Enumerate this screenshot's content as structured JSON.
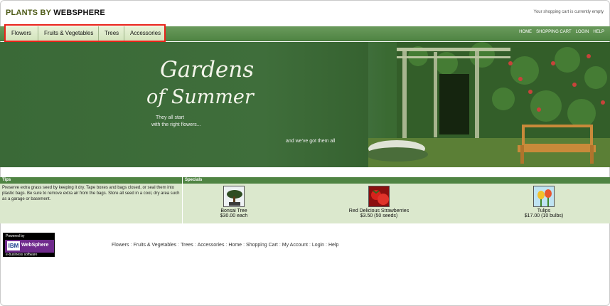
{
  "header": {
    "logo_part1": "PLANTS BY",
    "logo_part2": "WEBSPHERE",
    "cart_status": "Your shopping cart is currently empty"
  },
  "nav": {
    "categories": [
      "Flowers",
      "Fruits & Vegetables",
      "Trees",
      "Accessories"
    ],
    "utility": [
      "HOME",
      "SHOPPING CART",
      "LOGIN",
      "HELP"
    ]
  },
  "banner": {
    "title_line1": "Gardens",
    "title_line2": "of Summer",
    "tagline1": "They all start",
    "tagline2": "with the right flowers...",
    "tagline3": "and we've got them all"
  },
  "tips": {
    "heading": "Tips",
    "text": "Preserve extra grass seed by keeping it dry. Tape boxes and bags closed, or seal them into plastic bags. Be sure to remove extra air from the bags. Store all seed in a cool, dry area such as a garage or basement."
  },
  "specials": {
    "heading": "Specials",
    "items": [
      {
        "name": "Bonsai Tree",
        "price": "$30.00 each",
        "icon": "bonsai-thumbnail"
      },
      {
        "name": "Red Delicious Strawberries",
        "price": "$3.50 (50 seeds)",
        "icon": "strawberry-thumbnail"
      },
      {
        "name": "Tulips",
        "price": "$17.00 (10 bulbs)",
        "icon": "tulips-thumbnail"
      }
    ]
  },
  "powered": {
    "line1": "Powered by",
    "ibm": "IBM",
    "product": "WebSphere",
    "line3": "e-business software"
  },
  "footer": {
    "links": [
      "Flowers",
      "Fruits & Vegetables",
      "Trees",
      "Accessories",
      "Home",
      "Shopping Cart",
      "My Account",
      "Login",
      "Help"
    ]
  },
  "colors": {
    "nav_green": "#4f8443",
    "banner_green": "#3f6e3b",
    "panel_green": "#dbe8cd",
    "highlight_red": "#e8231a"
  }
}
